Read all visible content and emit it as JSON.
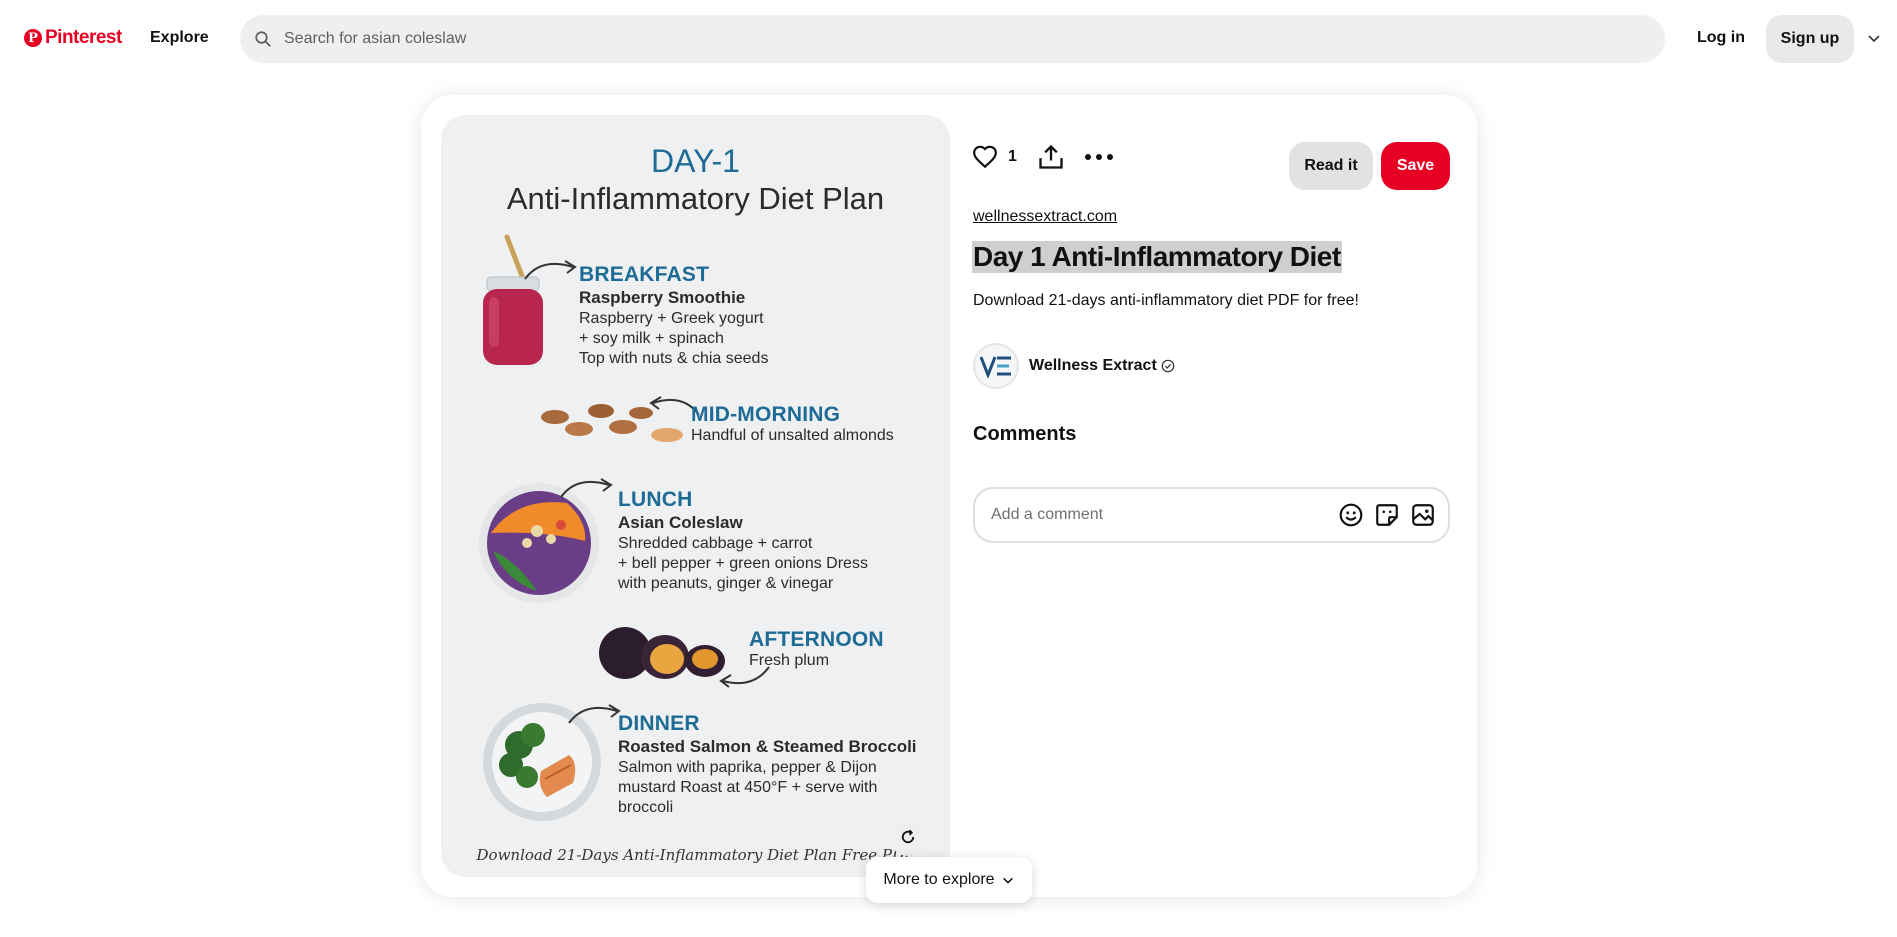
{
  "header": {
    "logo_text": "Pinterest",
    "explore_label": "Explore",
    "search_placeholder": "Search for asian coleslaw",
    "login_label": "Log in",
    "signup_label": "Sign up"
  },
  "pin_image": {
    "day": "DAY-1",
    "title": "Anti-Inflammatory Diet Plan",
    "breakfast": {
      "heading": "BREAKFAST",
      "dish": "Raspberry Smoothie",
      "lines": [
        "Raspberry + Greek yogurt",
        "+ soy milk + spinach",
        "Top with nuts & chia seeds"
      ]
    },
    "midmorning": {
      "heading": "MID-MORNING",
      "lines": [
        "Handful of unsalted almonds"
      ]
    },
    "lunch": {
      "heading": "LUNCH",
      "dish": "Asian Coleslaw",
      "lines": [
        "Shredded cabbage + carrot",
        "+ bell pepper + green onions Dress",
        "with peanuts, ginger & vinegar"
      ]
    },
    "afternoon": {
      "heading": "AFTERNOON",
      "lines": [
        "Fresh plum"
      ]
    },
    "dinner": {
      "heading": "DINNER",
      "dish": "Roasted Salmon & Steamed Broccoli",
      "lines": [
        "Salmon with paprika, pepper & Dijon",
        "mustard Roast at 450°F + serve with",
        "broccoli"
      ]
    },
    "footer": "Download 21-Days Anti-Inflammatory Diet Plan Free PDF"
  },
  "actions": {
    "like_count": "1",
    "read_it_label": "Read it",
    "save_label": "Save"
  },
  "pin": {
    "source": "wellnessextract.com",
    "title": "Day 1 Anti-Inflammatory Diet",
    "description": "Download 21-days anti-inflammatory diet PDF for free!",
    "creator_name": "Wellness Extract",
    "comments_heading": "Comments",
    "comment_placeholder": "Add a comment"
  },
  "more_to_explore_label": "More to explore",
  "colors": {
    "brand": "#e60023",
    "heading_blue": "#1e6b96",
    "image_bg": "#eff0f1"
  }
}
